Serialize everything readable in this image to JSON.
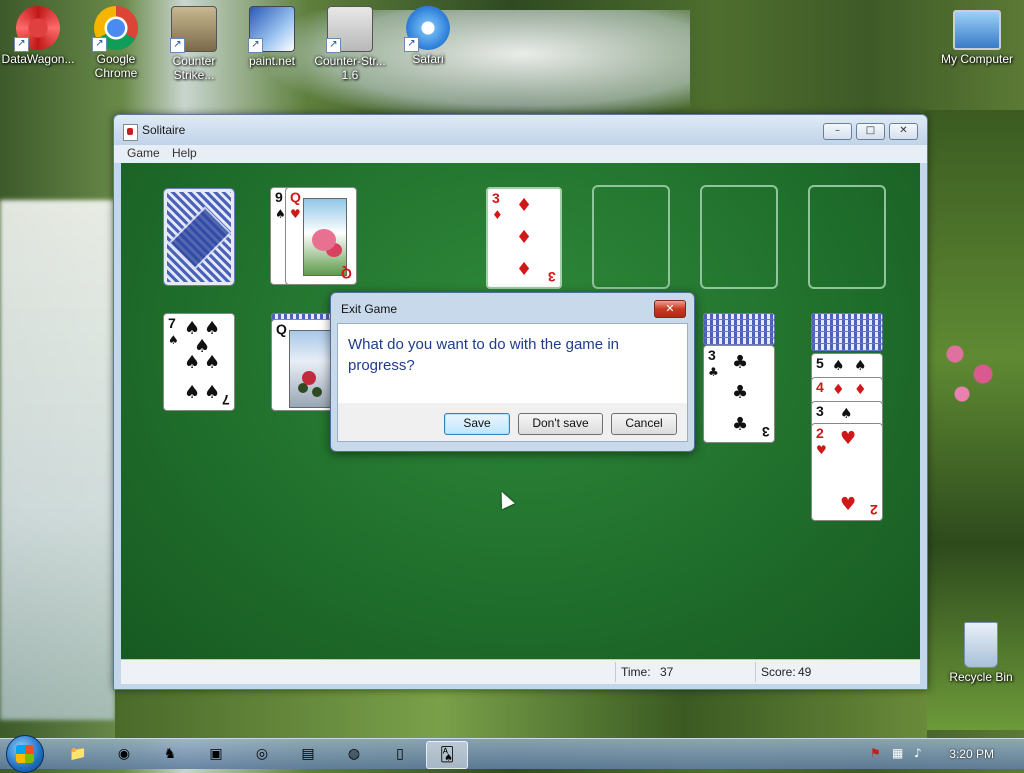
{
  "desktop": {
    "icons": [
      {
        "label": "DataWagon...",
        "icon": "datawagon-icon"
      },
      {
        "label": "Google Chrome",
        "icon": "chrome-icon"
      },
      {
        "label": "Counter Strike...",
        "icon": "counter-strike-icon"
      },
      {
        "label": "paint.net",
        "icon": "paint-net-icon"
      },
      {
        "label": "Counter-Str... 1.6",
        "icon": "counter-strike-16-icon"
      },
      {
        "label": "Safari",
        "icon": "safari-icon"
      },
      {
        "label": "My Computer",
        "icon": "computer-icon"
      },
      {
        "label": "Recycle Bin",
        "icon": "recycle-bin-icon"
      }
    ]
  },
  "window": {
    "title": "Solitaire",
    "controls": {
      "minimize": "–",
      "maximize": "□",
      "close": "✕"
    },
    "menu": [
      "Game",
      "Help"
    ]
  },
  "game": {
    "stock": {
      "face": "down"
    },
    "waste": [
      {
        "rank": "9",
        "suit": "♠",
        "color": "black"
      },
      {
        "rank": "Q",
        "suit": "♥",
        "color": "red"
      }
    ],
    "foundations": [
      {
        "rank": "3",
        "suit": "♦",
        "color": "red"
      },
      {
        "empty": true
      },
      {
        "empty": true
      },
      {
        "empty": true
      }
    ],
    "tableau": [
      {
        "rank": "7",
        "suit": "♠",
        "color": "black"
      },
      {
        "rank": "Q",
        "suit": "♠",
        "color": "black"
      },
      {
        "rank": "3",
        "suit": "♣",
        "color": "black"
      },
      {
        "cascade": [
          {
            "rank": "5",
            "suit": "♠",
            "color": "black"
          },
          {
            "rank": "4",
            "suit": "♦",
            "color": "red"
          },
          {
            "rank": "3",
            "suit": "♠",
            "color": "black"
          },
          {
            "rank": "2",
            "suit": "♥",
            "color": "red"
          }
        ]
      }
    ]
  },
  "status": {
    "time_label": "Time:",
    "time_value": "37",
    "score_label": "Score:",
    "score_value": "49"
  },
  "dialog": {
    "title": "Exit Game",
    "message": "What do you want to do with the game in progress?",
    "buttons": {
      "save": "Save",
      "dont_save": "Don't save",
      "cancel": "Cancel"
    },
    "close_glyph": "✕"
  },
  "taskbar": {
    "clock": "3:20 PM",
    "apps": [
      "explorer-icon",
      "chrome-icon",
      "counter-strike-icon",
      "paint-net-icon",
      "network-icon",
      "media-icon",
      "notepad-icon",
      "solitaire-icon"
    ]
  },
  "colors": {
    "felt": "#1f6d2b",
    "card_red": "#d01818",
    "dialog_text": "#1f3d8a"
  }
}
